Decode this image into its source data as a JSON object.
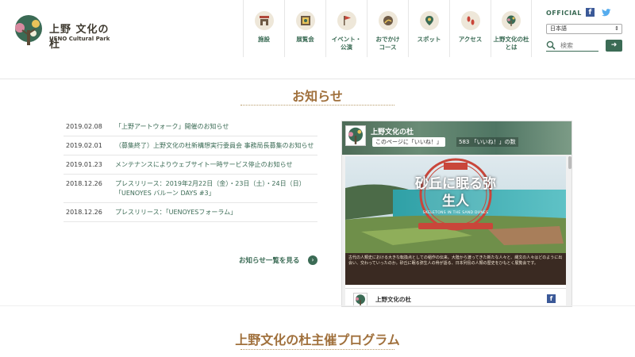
{
  "logo": {
    "name_ja": "上野 文化の杜",
    "name_en": "UENO Cultural Park"
  },
  "nav": [
    {
      "label": "施設",
      "icon": "facility-icon"
    },
    {
      "label": "展覧会",
      "icon": "exhibition-icon"
    },
    {
      "label": "イベント・\n公演",
      "icon": "event-flag-icon"
    },
    {
      "label": "おでかけ\nコース",
      "icon": "course-icon"
    },
    {
      "label": "スポット",
      "icon": "spot-pin-icon"
    },
    {
      "label": "アクセス",
      "icon": "access-footprint-icon"
    },
    {
      "label": "上野文化の杜\nとは",
      "icon": "about-tree-icon"
    }
  ],
  "header_right": {
    "official_label": "OFFICIAL",
    "language_selected": "日本語",
    "search_placeholder": "検索",
    "search_button": "➜"
  },
  "colors": {
    "accent_green": "#3b6b55",
    "title_brown": "#a0703c"
  },
  "news": {
    "title": "お知らせ",
    "items": [
      {
        "date": "2019.02.08",
        "text": "「上野アートウォーク」開催のお知らせ"
      },
      {
        "date": "2019.02.01",
        "text": "（募集終了）上野文化の杜新構想実行委員会 事務局長募集のお知らせ"
      },
      {
        "date": "2019.01.23",
        "text": "メンテナンスによりウェブサイト一時サービス停止のお知らせ"
      },
      {
        "date": "2018.12.26",
        "text": "プレスリリース：2019年2月22日（金）・23日（土）・24日（日）「UENOYES バルーン DAYS #3」"
      },
      {
        "date": "2018.12.26",
        "text": "プレスリリース：「UENOYESフォーラム」"
      }
    ],
    "more_label": "お知らせ一覧を見る"
  },
  "facebook": {
    "page_name": "上野文化の杜",
    "like_button": "このページに「いいね！」",
    "like_count": "583 「いいね！」の数",
    "post_title_ja": "砂丘に眠る弥生人",
    "post_subtitle_en": "SKELETONS IN THE SAND DUNES",
    "post_text": "古代の人類史における大きな転換点としての稲作の伝来。大陸から渡ってきた新たな人々と、縄文の人々はどのように出会い、交わっていったのか。砂丘に眠る弥生人の骨が語る、日本列島の人類の歴史をひもとく展覧会です。",
    "footer_name": "上野文化の杜"
  },
  "program": {
    "title": "上野文化の杜主催プログラム"
  }
}
